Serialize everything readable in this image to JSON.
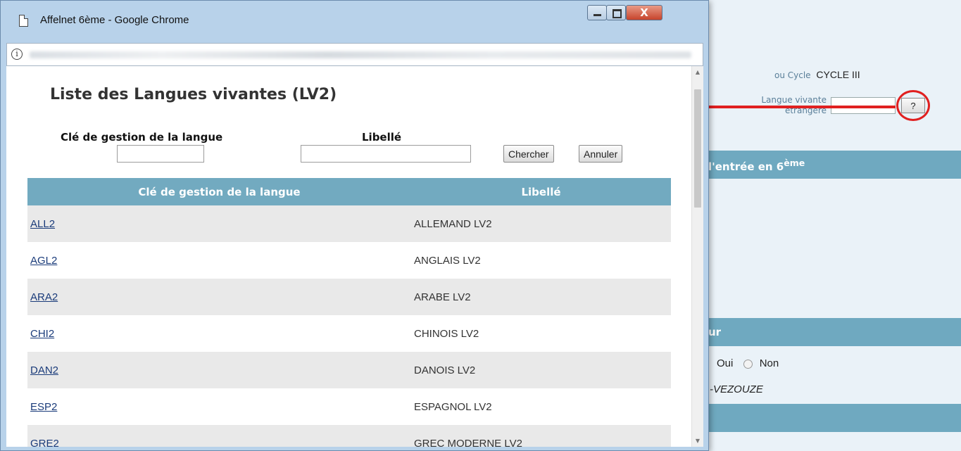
{
  "background": {
    "cycle_label": "ou Cycle",
    "cycle_value": "CYCLE III",
    "lang_label_line1": "Langue vivante",
    "lang_label_line2": "étrangère",
    "help_button_label": "?",
    "section1_text": "l'entrée en 6",
    "section1_sup": "ème",
    "section2_text": "ur",
    "radio_oui": "Oui",
    "radio_non": "Non",
    "vezouze_text": "-VEZOUZE",
    "colors": {
      "band": "#6fa9c0",
      "highlight": "#e02020"
    }
  },
  "window": {
    "title": "Affelnet 6ème - Google Chrome",
    "close_label": "X",
    "page_icon": "page-icon",
    "info_icon": "info-icon"
  },
  "popup": {
    "title": "Liste des Langues vivantes (LV2)",
    "search": {
      "key_label": "Clé de gestion de la langue",
      "libelle_label": "Libellé",
      "key_value": "",
      "libelle_value": "",
      "search_button": "Chercher",
      "cancel_button": "Annuler"
    },
    "table": {
      "headers": [
        "Clé de gestion de la langue",
        "Libellé"
      ],
      "rows": [
        {
          "key": "ALL2",
          "label": "ALLEMAND LV2"
        },
        {
          "key": "AGL2",
          "label": "ANGLAIS LV2"
        },
        {
          "key": "ARA2",
          "label": "ARABE LV2"
        },
        {
          "key": "CHI2",
          "label": "CHINOIS LV2"
        },
        {
          "key": "DAN2",
          "label": "DANOIS LV2"
        },
        {
          "key": "ESP2",
          "label": "ESPAGNOL LV2"
        },
        {
          "key": "GRE2",
          "label": "GREC MODERNE LV2"
        }
      ],
      "colors": {
        "header_bg": "#72aac0",
        "row_alt_bg": "#e9e9e9",
        "link": "#1a3b7a"
      }
    }
  }
}
